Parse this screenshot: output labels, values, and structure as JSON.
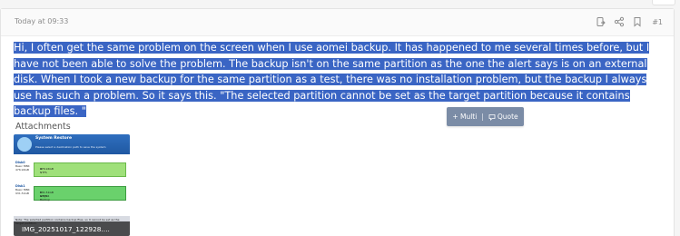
{
  "post": {
    "date": "Today at 09:33",
    "number": "#1",
    "actions": [
      {
        "name": "share-alt-icon"
      },
      {
        "name": "share-icon"
      },
      {
        "name": "bookmark-icon"
      }
    ],
    "message": "Hi, I often get the same problem on the screen when I use aomei backup. It has happened to me several times before, but I have not been able to solve the problem. The backup isn't on the same partition as the one the alert says is on an external disk. When I took a new backup for the same partition as a test, there was no installation problem, but the backup I always use has such a problem. So it says this. \"The selected partition cannot be set as the target partition because it contains backup files. \"",
    "selection_color": "#3a65c4"
  },
  "tooltip": {
    "multi_label": "+ Multi",
    "separator": "|",
    "quote_label": "Quote"
  },
  "attachments": {
    "title": "Attachments",
    "items": [
      {
        "filename": "IMG_20251017_122928....",
        "preview": {
          "title": "System Restore",
          "subtitle": "Please select a destination path to save the system",
          "disks": [
            {
              "label": "Disk0",
              "info": "Basic MBR",
              "size": "476.94GB",
              "bar_text": "D:",
              "bar_sub": "476.94GB NTFS"
            },
            {
              "label": "Disk1",
              "info": "Basic MBR",
              "size": "931.51GB",
              "bar_text": "E: ercy56 Backup",
              "bar_sub": "931.51GB NTFS"
            }
          ],
          "note": "Note: The selected partition contains backup files, so it cannot be set as the target partition."
        }
      }
    ]
  }
}
